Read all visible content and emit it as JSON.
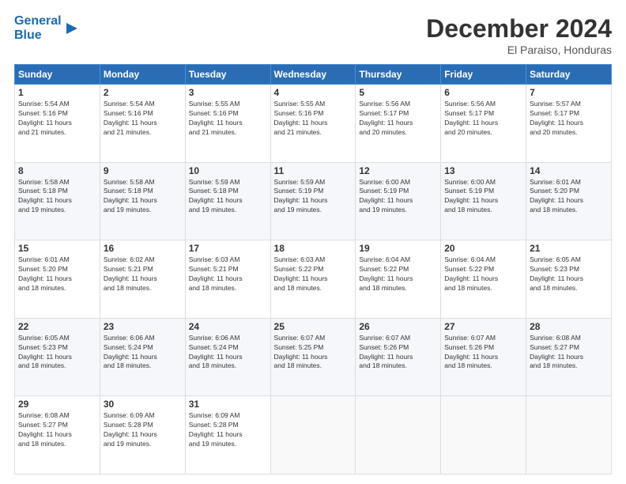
{
  "logo": {
    "line1": "General",
    "line2": "Blue"
  },
  "title": "December 2024",
  "location": "El Paraiso, Honduras",
  "days_header": [
    "Sunday",
    "Monday",
    "Tuesday",
    "Wednesday",
    "Thursday",
    "Friday",
    "Saturday"
  ],
  "weeks": [
    [
      {
        "day": "1",
        "info": "Sunrise: 5:54 AM\nSunset: 5:16 PM\nDaylight: 11 hours\nand 21 minutes."
      },
      {
        "day": "2",
        "info": "Sunrise: 5:54 AM\nSunset: 5:16 PM\nDaylight: 11 hours\nand 21 minutes."
      },
      {
        "day": "3",
        "info": "Sunrise: 5:55 AM\nSunset: 5:16 PM\nDaylight: 11 hours\nand 21 minutes."
      },
      {
        "day": "4",
        "info": "Sunrise: 5:55 AM\nSunset: 5:16 PM\nDaylight: 11 hours\nand 21 minutes."
      },
      {
        "day": "5",
        "info": "Sunrise: 5:56 AM\nSunset: 5:17 PM\nDaylight: 11 hours\nand 20 minutes."
      },
      {
        "day": "6",
        "info": "Sunrise: 5:56 AM\nSunset: 5:17 PM\nDaylight: 11 hours\nand 20 minutes."
      },
      {
        "day": "7",
        "info": "Sunrise: 5:57 AM\nSunset: 5:17 PM\nDaylight: 11 hours\nand 20 minutes."
      }
    ],
    [
      {
        "day": "8",
        "info": "Sunrise: 5:58 AM\nSunset: 5:18 PM\nDaylight: 11 hours\nand 19 minutes."
      },
      {
        "day": "9",
        "info": "Sunrise: 5:58 AM\nSunset: 5:18 PM\nDaylight: 11 hours\nand 19 minutes."
      },
      {
        "day": "10",
        "info": "Sunrise: 5:59 AM\nSunset: 5:18 PM\nDaylight: 11 hours\nand 19 minutes."
      },
      {
        "day": "11",
        "info": "Sunrise: 5:59 AM\nSunset: 5:19 PM\nDaylight: 11 hours\nand 19 minutes."
      },
      {
        "day": "12",
        "info": "Sunrise: 6:00 AM\nSunset: 5:19 PM\nDaylight: 11 hours\nand 19 minutes."
      },
      {
        "day": "13",
        "info": "Sunrise: 6:00 AM\nSunset: 5:19 PM\nDaylight: 11 hours\nand 18 minutes."
      },
      {
        "day": "14",
        "info": "Sunrise: 6:01 AM\nSunset: 5:20 PM\nDaylight: 11 hours\nand 18 minutes."
      }
    ],
    [
      {
        "day": "15",
        "info": "Sunrise: 6:01 AM\nSunset: 5:20 PM\nDaylight: 11 hours\nand 18 minutes."
      },
      {
        "day": "16",
        "info": "Sunrise: 6:02 AM\nSunset: 5:21 PM\nDaylight: 11 hours\nand 18 minutes."
      },
      {
        "day": "17",
        "info": "Sunrise: 6:03 AM\nSunset: 5:21 PM\nDaylight: 11 hours\nand 18 minutes."
      },
      {
        "day": "18",
        "info": "Sunrise: 6:03 AM\nSunset: 5:22 PM\nDaylight: 11 hours\nand 18 minutes."
      },
      {
        "day": "19",
        "info": "Sunrise: 6:04 AM\nSunset: 5:22 PM\nDaylight: 11 hours\nand 18 minutes."
      },
      {
        "day": "20",
        "info": "Sunrise: 6:04 AM\nSunset: 5:22 PM\nDaylight: 11 hours\nand 18 minutes."
      },
      {
        "day": "21",
        "info": "Sunrise: 6:05 AM\nSunset: 5:23 PM\nDaylight: 11 hours\nand 18 minutes."
      }
    ],
    [
      {
        "day": "22",
        "info": "Sunrise: 6:05 AM\nSunset: 5:23 PM\nDaylight: 11 hours\nand 18 minutes."
      },
      {
        "day": "23",
        "info": "Sunrise: 6:06 AM\nSunset: 5:24 PM\nDaylight: 11 hours\nand 18 minutes."
      },
      {
        "day": "24",
        "info": "Sunrise: 6:06 AM\nSunset: 5:24 PM\nDaylight: 11 hours\nand 18 minutes."
      },
      {
        "day": "25",
        "info": "Sunrise: 6:07 AM\nSunset: 5:25 PM\nDaylight: 11 hours\nand 18 minutes."
      },
      {
        "day": "26",
        "info": "Sunrise: 6:07 AM\nSunset: 5:26 PM\nDaylight: 11 hours\nand 18 minutes."
      },
      {
        "day": "27",
        "info": "Sunrise: 6:07 AM\nSunset: 5:26 PM\nDaylight: 11 hours\nand 18 minutes."
      },
      {
        "day": "28",
        "info": "Sunrise: 6:08 AM\nSunset: 5:27 PM\nDaylight: 11 hours\nand 18 minutes."
      }
    ],
    [
      {
        "day": "29",
        "info": "Sunrise: 6:08 AM\nSunset: 5:27 PM\nDaylight: 11 hours\nand 18 minutes."
      },
      {
        "day": "30",
        "info": "Sunrise: 6:09 AM\nSunset: 5:28 PM\nDaylight: 11 hours\nand 19 minutes."
      },
      {
        "day": "31",
        "info": "Sunrise: 6:09 AM\nSunset: 5:28 PM\nDaylight: 11 hours\nand 19 minutes."
      },
      {
        "day": "",
        "info": ""
      },
      {
        "day": "",
        "info": ""
      },
      {
        "day": "",
        "info": ""
      },
      {
        "day": "",
        "info": ""
      }
    ]
  ]
}
